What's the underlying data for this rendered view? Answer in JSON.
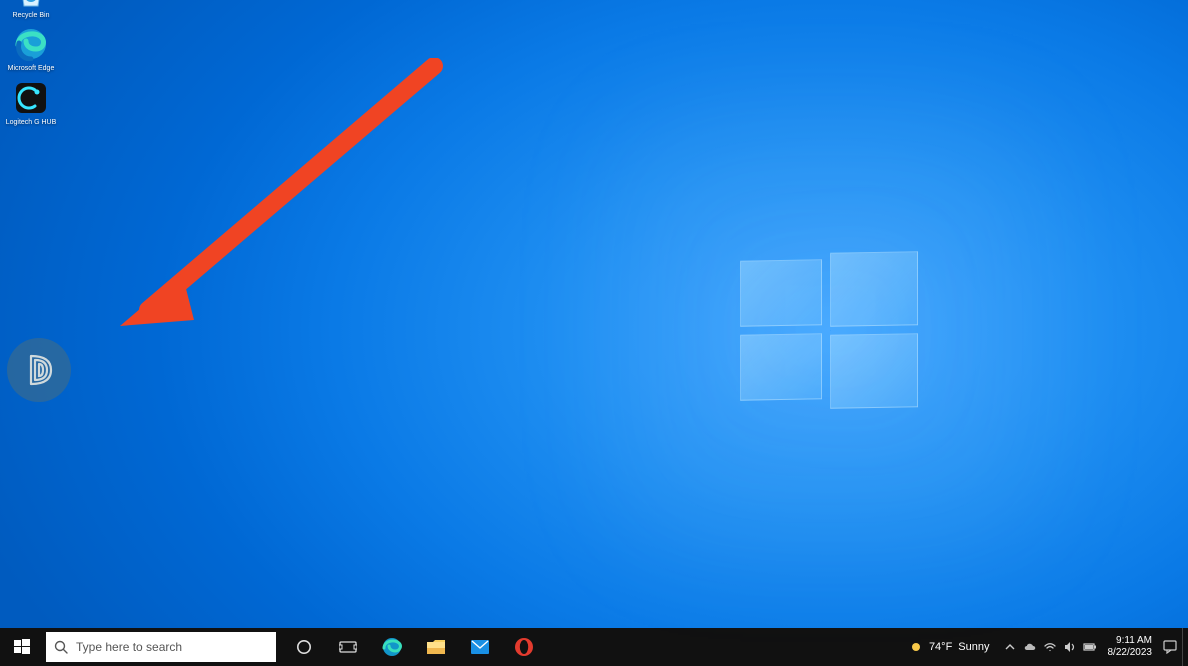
{
  "desktop_icons": [
    {
      "name": "recycle-bin",
      "label": "Recycle Bin"
    },
    {
      "name": "microsoft-edge",
      "label": "Microsoft Edge"
    },
    {
      "name": "logitech-ghub",
      "label": "Logitech G HUB"
    }
  ],
  "taskbar": {
    "search_placeholder": "Type here to search",
    "pinned": [
      {
        "name": "cortana",
        "icon": "cortana-icon"
      },
      {
        "name": "task-view",
        "icon": "task-view-icon"
      },
      {
        "name": "edge",
        "icon": "edge-icon"
      },
      {
        "name": "file-explorer",
        "icon": "folder-icon"
      },
      {
        "name": "mail",
        "icon": "mail-icon"
      },
      {
        "name": "opera",
        "icon": "opera-icon"
      }
    ],
    "weather": {
      "temp": "74°F",
      "condition": "Sunny"
    },
    "clock": {
      "time": "9:11 AM",
      "date": "8/22/2023"
    }
  },
  "annotation": {
    "type": "arrow",
    "color": "#f04423",
    "points_to": "floating-widget"
  },
  "colors": {
    "accent": "#0a7ae6",
    "taskbar_bg": "#111111",
    "search_bg": "#ffffff",
    "arrow": "#f04423"
  }
}
